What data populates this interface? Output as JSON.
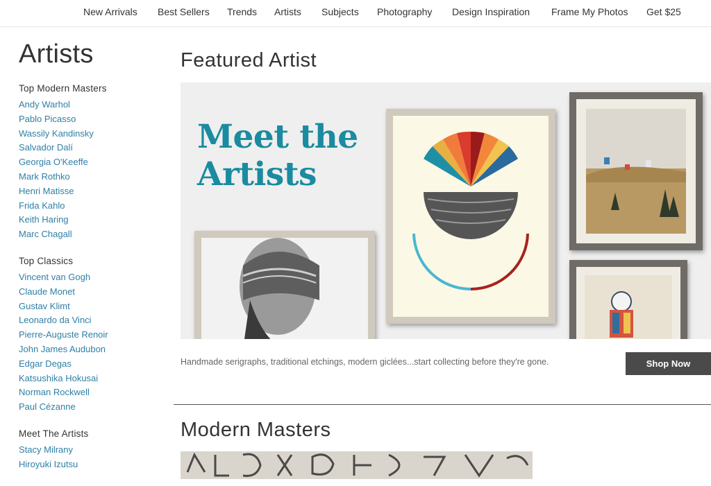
{
  "nav": {
    "items": [
      "New Arrivals",
      "Best Sellers",
      "Trends",
      "Artists",
      "Subjects",
      "Photography",
      "Design Inspiration",
      "Frame My Photos",
      "Get $25"
    ]
  },
  "sidebar": {
    "title": "Artists",
    "groups": [
      {
        "heading": "Top Modern Masters",
        "links": [
          "Andy Warhol",
          "Pablo Picasso",
          "Wassily Kandinsky",
          "Salvador Dalí",
          "Georgia O'Keeffe",
          "Mark Rothko",
          "Henri Matisse",
          "Frida Kahlo",
          "Keith Haring",
          "Marc Chagall"
        ]
      },
      {
        "heading": "Top Classics",
        "links": [
          "Vincent van Gogh",
          "Claude Monet",
          "Gustav Klimt",
          "Leonardo da Vinci",
          "Pierre-Auguste Renoir",
          "John James Audubon",
          "Edgar Degas",
          "Katsushika Hokusai",
          "Norman Rockwell",
          "Paul Cézanne"
        ]
      },
      {
        "heading": "Meet The Artists",
        "links": [
          "Stacy Milrany",
          "Hiroyuki Izutsu"
        ]
      }
    ]
  },
  "featured": {
    "title": "Featured Artist",
    "banner_line1": "Meet the",
    "banner_line2": "Artists",
    "tagline": "Handmade serigraphs, traditional etchings, modern giclées...start collecting before they're gone.",
    "cta": "Shop Now"
  },
  "modern": {
    "title": "Modern Masters"
  },
  "colors": {
    "link": "#2e7fa6",
    "banner_heading": "#1a8ba0",
    "button_bg": "#4a4a4a"
  }
}
